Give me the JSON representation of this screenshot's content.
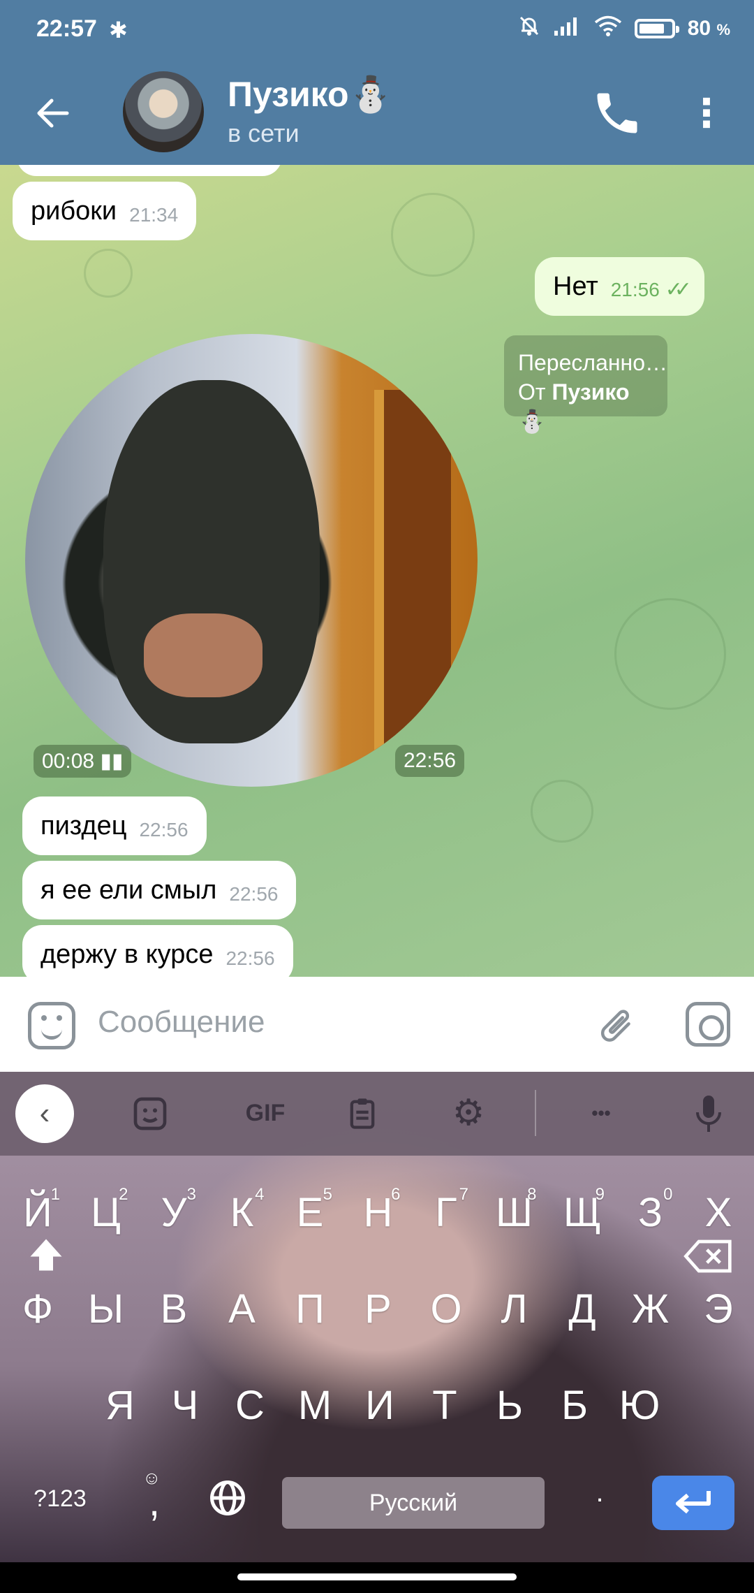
{
  "status_bar": {
    "time": "22:57",
    "battery_percent": "80",
    "battery_unit": "%",
    "battery_level": 0.8,
    "icons": [
      "bluetooth-icon",
      "muted-bell-icon",
      "signal-icon",
      "wifi-icon",
      "battery-icon"
    ]
  },
  "header": {
    "title": "Пузико⛄",
    "status": "в сети",
    "icons": [
      "back-arrow-icon",
      "phone-icon",
      "more-vert-icon"
    ]
  },
  "messages": [
    {
      "side": "in",
      "text": "рибоки",
      "time": "21:34"
    },
    {
      "side": "out",
      "text": "Нет",
      "time": "21:56",
      "read": true
    },
    {
      "side": "out",
      "type": "forward",
      "line1": "Пересланно…",
      "from_label": "От",
      "from_name": "Пузико⛄"
    },
    {
      "side": "in",
      "type": "video_note",
      "duration": "00:08",
      "time": "22:56"
    },
    {
      "side": "in",
      "text": "пиздец",
      "time": "22:56"
    },
    {
      "side": "in",
      "text": "я ее ели смыл",
      "time": "22:56"
    },
    {
      "side": "in",
      "text": "держу в курсе",
      "time": "22:56"
    }
  ],
  "input": {
    "placeholder": "Сообщение",
    "icons": [
      "sticker-icon",
      "attach-icon",
      "camera-icon"
    ]
  },
  "keyboard": {
    "toolbar": {
      "gif_label": "GIF",
      "more_label": "•••",
      "icons": [
        "back-chevron-icon",
        "sticker-icon",
        "gif-icon",
        "clipboard-icon",
        "settings-icon",
        "more-icon",
        "mic-icon"
      ]
    },
    "row1": [
      "Й",
      "Ц",
      "У",
      "К",
      "Е",
      "Н",
      "Г",
      "Ш",
      "Щ",
      "З",
      "Х"
    ],
    "row1_hints": [
      "1",
      "2",
      "3",
      "4",
      "5",
      "6",
      "7",
      "8",
      "9",
      "0",
      ""
    ],
    "row2": [
      "Ф",
      "Ы",
      "В",
      "А",
      "П",
      "Р",
      "О",
      "Л",
      "Д",
      "Ж",
      "Э"
    ],
    "row3": [
      "Я",
      "Ч",
      "С",
      "М",
      "И",
      "Т",
      "Ь",
      "Б",
      "Ю"
    ],
    "symbols_label": "?123",
    "comma_label": ",",
    "space_label": "Русский",
    "period_label": ".",
    "icons": [
      "shift-icon",
      "backspace-icon",
      "emoji-icon",
      "globe-icon",
      "enter-icon"
    ]
  }
}
